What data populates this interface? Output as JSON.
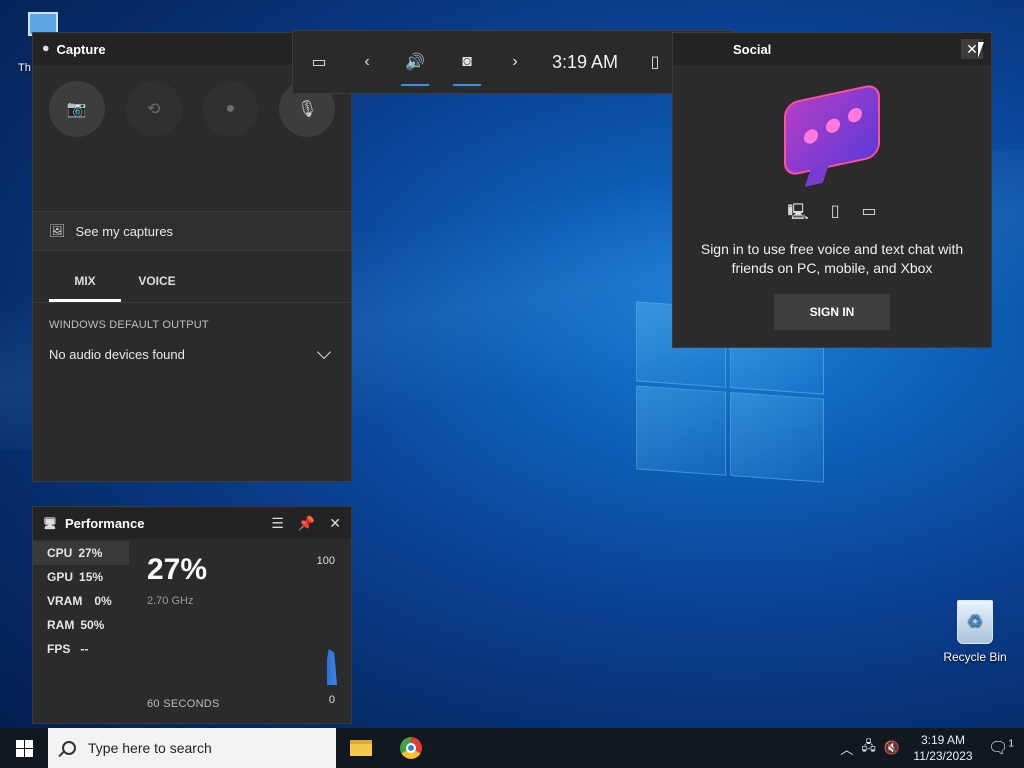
{
  "desktop": {
    "this_pc_label": "Th",
    "recycle_bin_label": "Recycle Bin"
  },
  "capture": {
    "title": "Capture",
    "see_captures": "See my captures",
    "tabs": [
      "MIX",
      "VOICE"
    ],
    "output_label": "WINDOWS DEFAULT OUTPUT",
    "output_value": "No audio devices found"
  },
  "topbar": {
    "time": "3:19 AM"
  },
  "social": {
    "title": "Social",
    "message": "Sign in to use free voice and text chat with friends on PC, mobile, and Xbox",
    "sign_in_label": "SIGN IN"
  },
  "performance": {
    "title": "Performance",
    "metrics": [
      {
        "name": "CPU",
        "value": "27%"
      },
      {
        "name": "GPU",
        "value": "15%"
      },
      {
        "name": "VRAM",
        "value": "0%"
      },
      {
        "name": "RAM",
        "value": "50%"
      },
      {
        "name": "FPS",
        "value": "--"
      }
    ],
    "big_value": "27%",
    "frequency": "2.70 GHz",
    "max_label": "100",
    "min_label": "0",
    "duration_label": "60 SECONDS"
  },
  "taskbar": {
    "search_placeholder": "Type here to search",
    "time": "3:19 AM",
    "date": "11/23/2023",
    "notification_count": "1"
  },
  "colors": {
    "accent": "#3a8ee6",
    "widget_bg": "#2b2b2b"
  }
}
